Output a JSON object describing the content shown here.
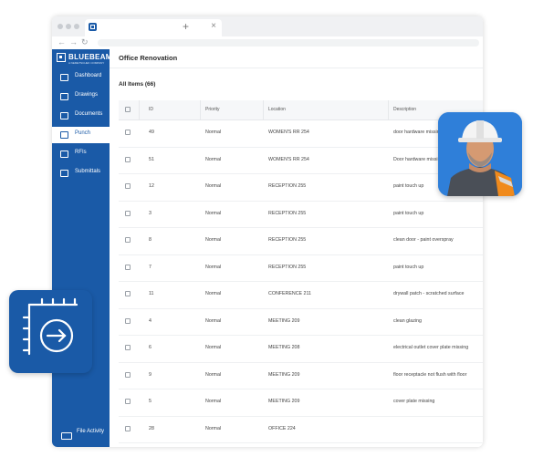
{
  "browser": {
    "tab_close": "×",
    "tab_new": "+",
    "nav": {
      "back": "←",
      "forward": "→",
      "reload": "↻"
    }
  },
  "brand": {
    "name": "BLUEBEAM",
    "tagline": "A NEMETSCHEK COMPANY",
    "color": "#1a5aa7"
  },
  "sidebar": {
    "items": [
      {
        "label": "Dashboard",
        "icon": "dashboard-icon"
      },
      {
        "label": "Drawings",
        "icon": "drawings-icon"
      },
      {
        "label": "Documents",
        "icon": "documents-icon"
      },
      {
        "label": "Punch",
        "icon": "punch-icon",
        "active": true
      },
      {
        "label": "RFIs",
        "icon": "rfis-icon"
      },
      {
        "label": "Submittals",
        "icon": "submittals-icon"
      }
    ],
    "footer_label": "File Activity"
  },
  "main": {
    "project_title": "Office Renovation",
    "items_title": "All Items (66)",
    "columns": [
      "ID",
      "Priority",
      "Location",
      "Description"
    ],
    "rows": [
      {
        "id": "49",
        "priority": "Normal",
        "location": "WOMEN'S RR 254",
        "description": "door hardware missing"
      },
      {
        "id": "51",
        "priority": "Normal",
        "location": "WOMEN'S RR 254",
        "description": "Door hardware missing"
      },
      {
        "id": "12",
        "priority": "Normal",
        "location": "RECEPTION 255",
        "description": "paint touch up"
      },
      {
        "id": "3",
        "priority": "Normal",
        "location": "RECEPTION 255",
        "description": "paint touch up"
      },
      {
        "id": "8",
        "priority": "Normal",
        "location": "RECEPTION 255",
        "description": "clean door - paint overspray"
      },
      {
        "id": "7",
        "priority": "Normal",
        "location": "RECEPTION 255",
        "description": "paint touch up"
      },
      {
        "id": "11",
        "priority": "Normal",
        "location": "CONFERENCE 211",
        "description": "drywall patch - scratched surface"
      },
      {
        "id": "4",
        "priority": "Normal",
        "location": "MEETING 209",
        "description": "clean glazing"
      },
      {
        "id": "6",
        "priority": "Normal",
        "location": "MEETING 208",
        "description": "electrical outlet cover plate missing"
      },
      {
        "id": "9",
        "priority": "Normal",
        "location": "MEETING 209",
        "description": "floor receptacle not flush with floor"
      },
      {
        "id": "5",
        "priority": "Normal",
        "location": "MEETING 209",
        "description": "cover plate missing"
      },
      {
        "id": "28",
        "priority": "Normal",
        "location": "OFFICE 224",
        "description": ""
      }
    ]
  },
  "overlays": {
    "avatar_icon": "construction-worker-avatar",
    "feature_icon": "punch-area-icon"
  }
}
